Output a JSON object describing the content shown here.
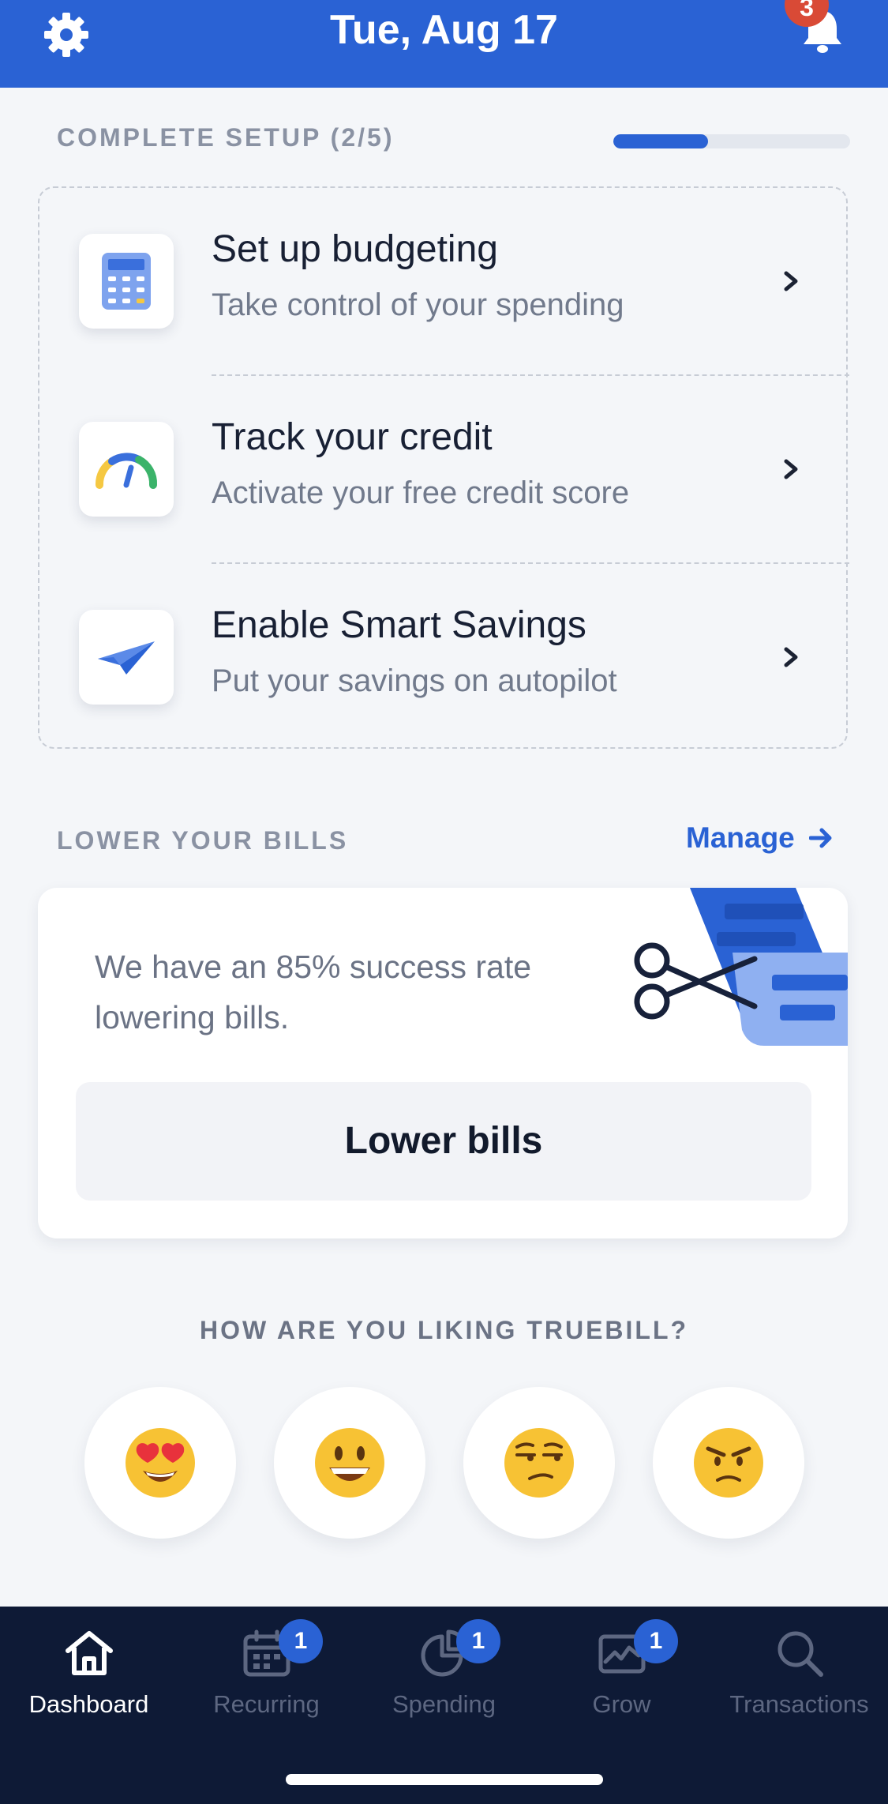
{
  "header": {
    "date": "Tue, Aug 17",
    "notification_count": "3",
    "settings_icon": "gear-icon",
    "bell_icon": "bell-icon",
    "color": "#2a62d4"
  },
  "setup": {
    "title": "COMPLETE SETUP (2/5)",
    "progress": 0.4,
    "items": [
      {
        "title": "Set up budgeting",
        "subtitle": "Take control of your spending",
        "icon": "calculator-icon"
      },
      {
        "title": "Track your credit",
        "subtitle": "Activate your free credit score",
        "icon": "credit-gauge-icon"
      },
      {
        "title": "Enable Smart Savings",
        "subtitle": "Put your savings on autopilot",
        "icon": "paper-plane-icon"
      }
    ]
  },
  "bills": {
    "title": "LOWER YOUR BILLS",
    "manage_label": "Manage",
    "description": "We have an 85% success rate lowering bills.",
    "button_label": "Lower bills",
    "illustration": "scissors-bill-illustration"
  },
  "feedback": {
    "title": "HOW ARE YOU LIKING TRUEBILL?",
    "options": [
      {
        "icon": "heart-eyes-emoji"
      },
      {
        "icon": "smiling-emoji"
      },
      {
        "icon": "unamused-emoji"
      },
      {
        "icon": "angry-emoji"
      }
    ]
  },
  "nav": {
    "items": [
      {
        "label": "Dashboard",
        "icon": "home-icon",
        "badge": ""
      },
      {
        "label": "Recurring",
        "icon": "calendar-icon",
        "badge": "1"
      },
      {
        "label": "Spending",
        "icon": "pie-chart-icon",
        "badge": "1"
      },
      {
        "label": "Grow",
        "icon": "growth-chart-icon",
        "badge": "1"
      },
      {
        "label": "Transactions",
        "icon": "search-icon",
        "badge": ""
      }
    ],
    "active": "Dashboard"
  }
}
